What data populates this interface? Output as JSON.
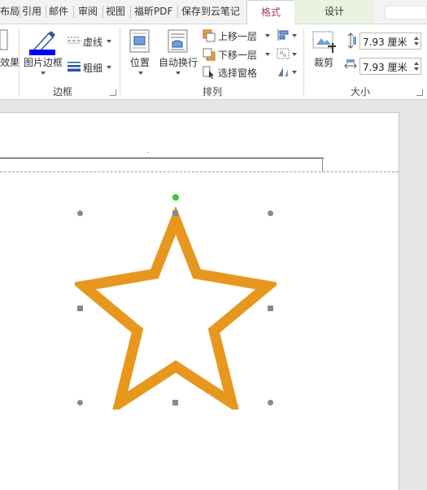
{
  "tabs": {
    "layout": "布局",
    "references": "引用",
    "mailings": "邮件",
    "review": "审阅",
    "view": "视图",
    "foxit_pdf": "福昕PDF",
    "save_cloud": "保存到云笔记",
    "format": "格式",
    "design": "设计"
  },
  "ribbon": {
    "effects_label": "效果",
    "picture_border_label": "图片边框",
    "dashes_label": "虚线",
    "weight_label": "粗细",
    "border_group": "边框",
    "position_label": "位置",
    "wrap_text_label": "自动换行",
    "bring_forward_label": "上移一层",
    "send_backward_label": "下移一层",
    "selection_pane_label": "选择窗格",
    "arrange_group": "排列",
    "crop_label": "裁剪",
    "height_value": "7.93 厘米",
    "width_value": "7.93 厘米",
    "size_group": "大小"
  },
  "colors": {
    "border_swatch": "#0000ff",
    "star_outline": "#e8971e",
    "rotate_handle": "#32cd32",
    "format_tab_text": "#a4376f"
  }
}
